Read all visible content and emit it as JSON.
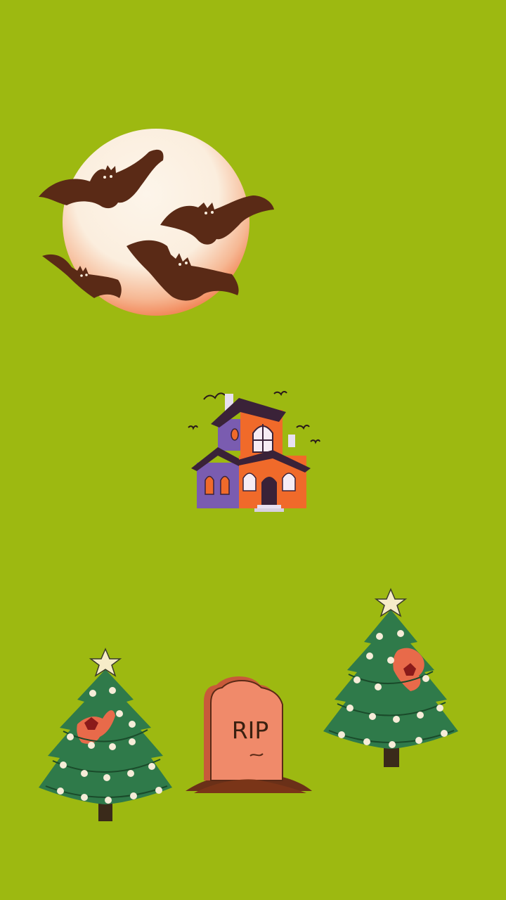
{
  "scene": {
    "background_color": "#9db911",
    "tombstone_text": "RIP"
  },
  "colors": {
    "moon": "#fbf1e3",
    "moon_glow": "#f07a4a",
    "bat": "#5a2a16",
    "house_purple": "#7a5cb0",
    "house_orange": "#f06a2a",
    "roof": "#3a2238",
    "tree_green": "#2f7a4a",
    "star": "#f6ecc8",
    "tombstone": "#f08a6a"
  },
  "icons": [
    "moon-icon",
    "bat-icon",
    "haunted-house-icon",
    "christmas-tree-icon",
    "tombstone-icon"
  ]
}
